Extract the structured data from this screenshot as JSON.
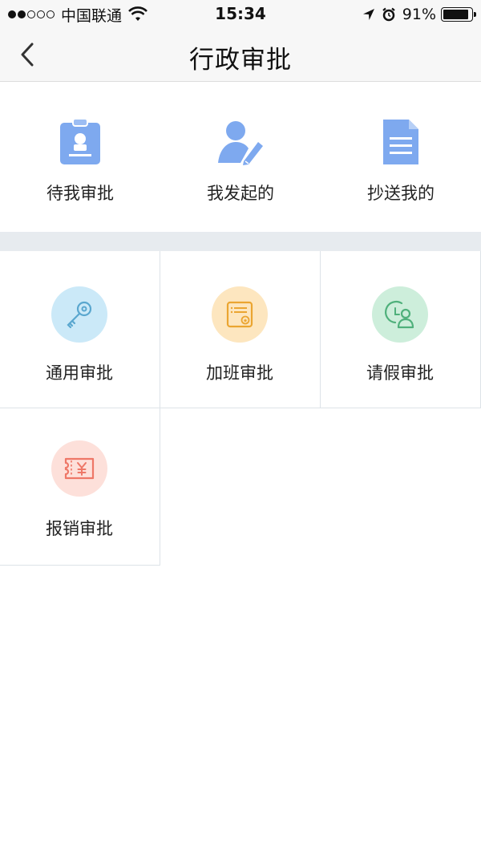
{
  "status_bar": {
    "carrier": "中国联通",
    "time": "15:34",
    "battery": "91%",
    "battery_level": 0.91,
    "signal_dots_filled": 2,
    "signal_dots_total": 5
  },
  "nav": {
    "back_icon": "chevron-left-icon",
    "title": "行政审批"
  },
  "quick_actions": [
    {
      "label": "待我审批",
      "icon": "id-badge-icon",
      "color": "#7ea9ef"
    },
    {
      "label": "我发起的",
      "icon": "user-edit-icon",
      "color": "#7ea9ef"
    },
    {
      "label": "抄送我的",
      "icon": "document-icon",
      "color": "#7ea9ef"
    }
  ],
  "approval_types": [
    {
      "label": "通用审批",
      "icon": "key-icon",
      "bg": "#cbe9f8",
      "color": "#5aa7cf"
    },
    {
      "label": "加班审批",
      "icon": "overtime-card-icon",
      "bg": "#fde6bf",
      "color": "#eba531"
    },
    {
      "label": "请假审批",
      "icon": "leave-person-clock-icon",
      "bg": "#cdeedb",
      "color": "#4fb07b"
    },
    {
      "label": "报销审批",
      "icon": "reimburse-ticket-icon",
      "bg": "#fde0da",
      "color": "#ee7767"
    }
  ]
}
